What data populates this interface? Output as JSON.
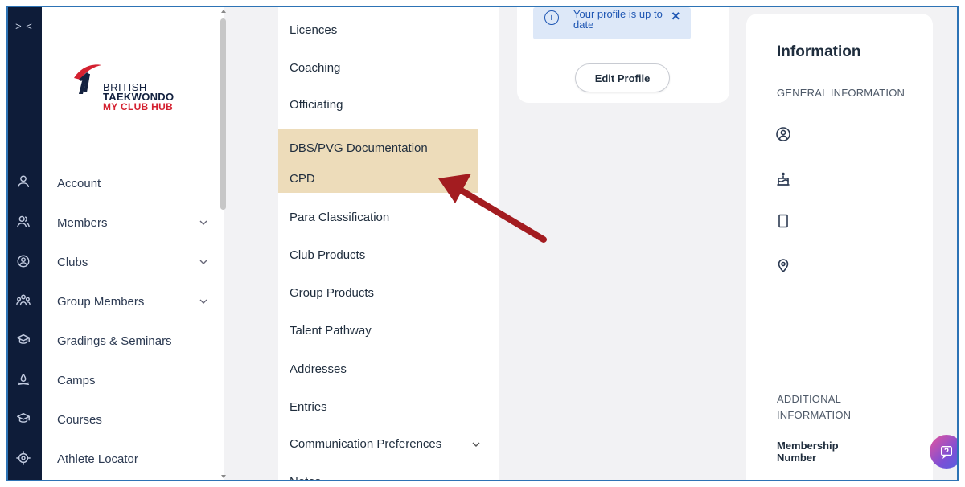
{
  "rail": {
    "toggle": ">  <",
    "icons": [
      "user-icon",
      "users-icon",
      "shield-user-icon",
      "group-icon",
      "graduation-cap-icon",
      "campfire-icon",
      "graduation-cap-icon",
      "locator-icon"
    ]
  },
  "logo": {
    "line1": "BRITISH",
    "line2": "TAEKWONDO",
    "line3": "MY CLUB HUB",
    "colors": {
      "navy": "#13213f",
      "red": "#d42130"
    }
  },
  "sidebar": {
    "items": [
      {
        "label": "Account",
        "chevron": false
      },
      {
        "label": "Members",
        "chevron": true
      },
      {
        "label": "Clubs",
        "chevron": true
      },
      {
        "label": "Group Members",
        "chevron": true
      },
      {
        "label": "Gradings & Seminars",
        "chevron": false
      },
      {
        "label": "Camps",
        "chevron": false
      },
      {
        "label": "Courses",
        "chevron": false
      },
      {
        "label": "Athlete Locator",
        "chevron": false
      }
    ]
  },
  "submenu": {
    "items": [
      {
        "label": "Licences"
      },
      {
        "label": "Coaching"
      },
      {
        "label": "Officiating"
      },
      {
        "label": "DBS/PVG Documentation",
        "highlighted": true
      },
      {
        "label": "CPD",
        "highlighted": true
      },
      {
        "label": "Para Classification"
      },
      {
        "label": "Club Products"
      },
      {
        "label": "Group Products"
      },
      {
        "label": "Talent Pathway"
      },
      {
        "label": "Addresses"
      },
      {
        "label": "Entries"
      },
      {
        "label": "Communication Preferences",
        "chevron": true
      },
      {
        "label": "Notes"
      }
    ],
    "highlight_color": "#eddcba"
  },
  "profile": {
    "alert_text": "Your profile is up to date",
    "edit_button": "Edit Profile"
  },
  "info": {
    "title": "Information",
    "general_heading": "GENERAL INFORMATION",
    "additional_heading": "ADDITIONAL INFORMATION",
    "membership_label": "Membership Number"
  },
  "annotation": {
    "arrow_color": "#a31c20"
  }
}
